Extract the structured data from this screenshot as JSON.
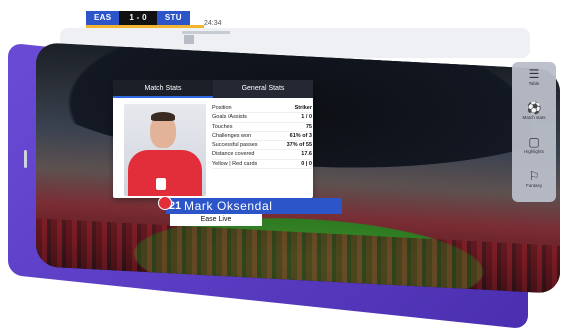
{
  "scoreboard": {
    "home_team": "EAS",
    "score": "1 - 0",
    "away_team": "STU",
    "clock": "24:34"
  },
  "tabs": [
    {
      "label": "Match Stats",
      "active": true
    },
    {
      "label": "General Stats",
      "active": false
    }
  ],
  "player": {
    "number": "21",
    "name": "Mark Oksendal",
    "club": "Ease Live"
  },
  "stats": [
    {
      "label": "Position",
      "value": "Striker"
    },
    {
      "label": "Goals /Assists",
      "value": "1 / 0"
    },
    {
      "label": "Touches",
      "value": "75"
    },
    {
      "label": "Challenges won",
      "value": "61% of 3"
    },
    {
      "label": "Successful passes",
      "value": "37% of 55"
    },
    {
      "label": "Distance covered",
      "value": "17.6"
    },
    {
      "label": "Yellow | Red cards",
      "value": "0 | 0"
    }
  ],
  "side_menu": [
    {
      "label": "Table",
      "icon": "table-icon"
    },
    {
      "label": "Match stats",
      "icon": "soccer-ball-icon"
    },
    {
      "label": "Highlights",
      "icon": "monitor-icon"
    },
    {
      "label": "Fantasy",
      "icon": "trophy-icon"
    }
  ],
  "colors": {
    "accent_blue": "#2b55c8",
    "accent_yellow": "#f2b431",
    "panel_purple": "#5a3cc8",
    "shirt_red": "#e22d3a"
  }
}
